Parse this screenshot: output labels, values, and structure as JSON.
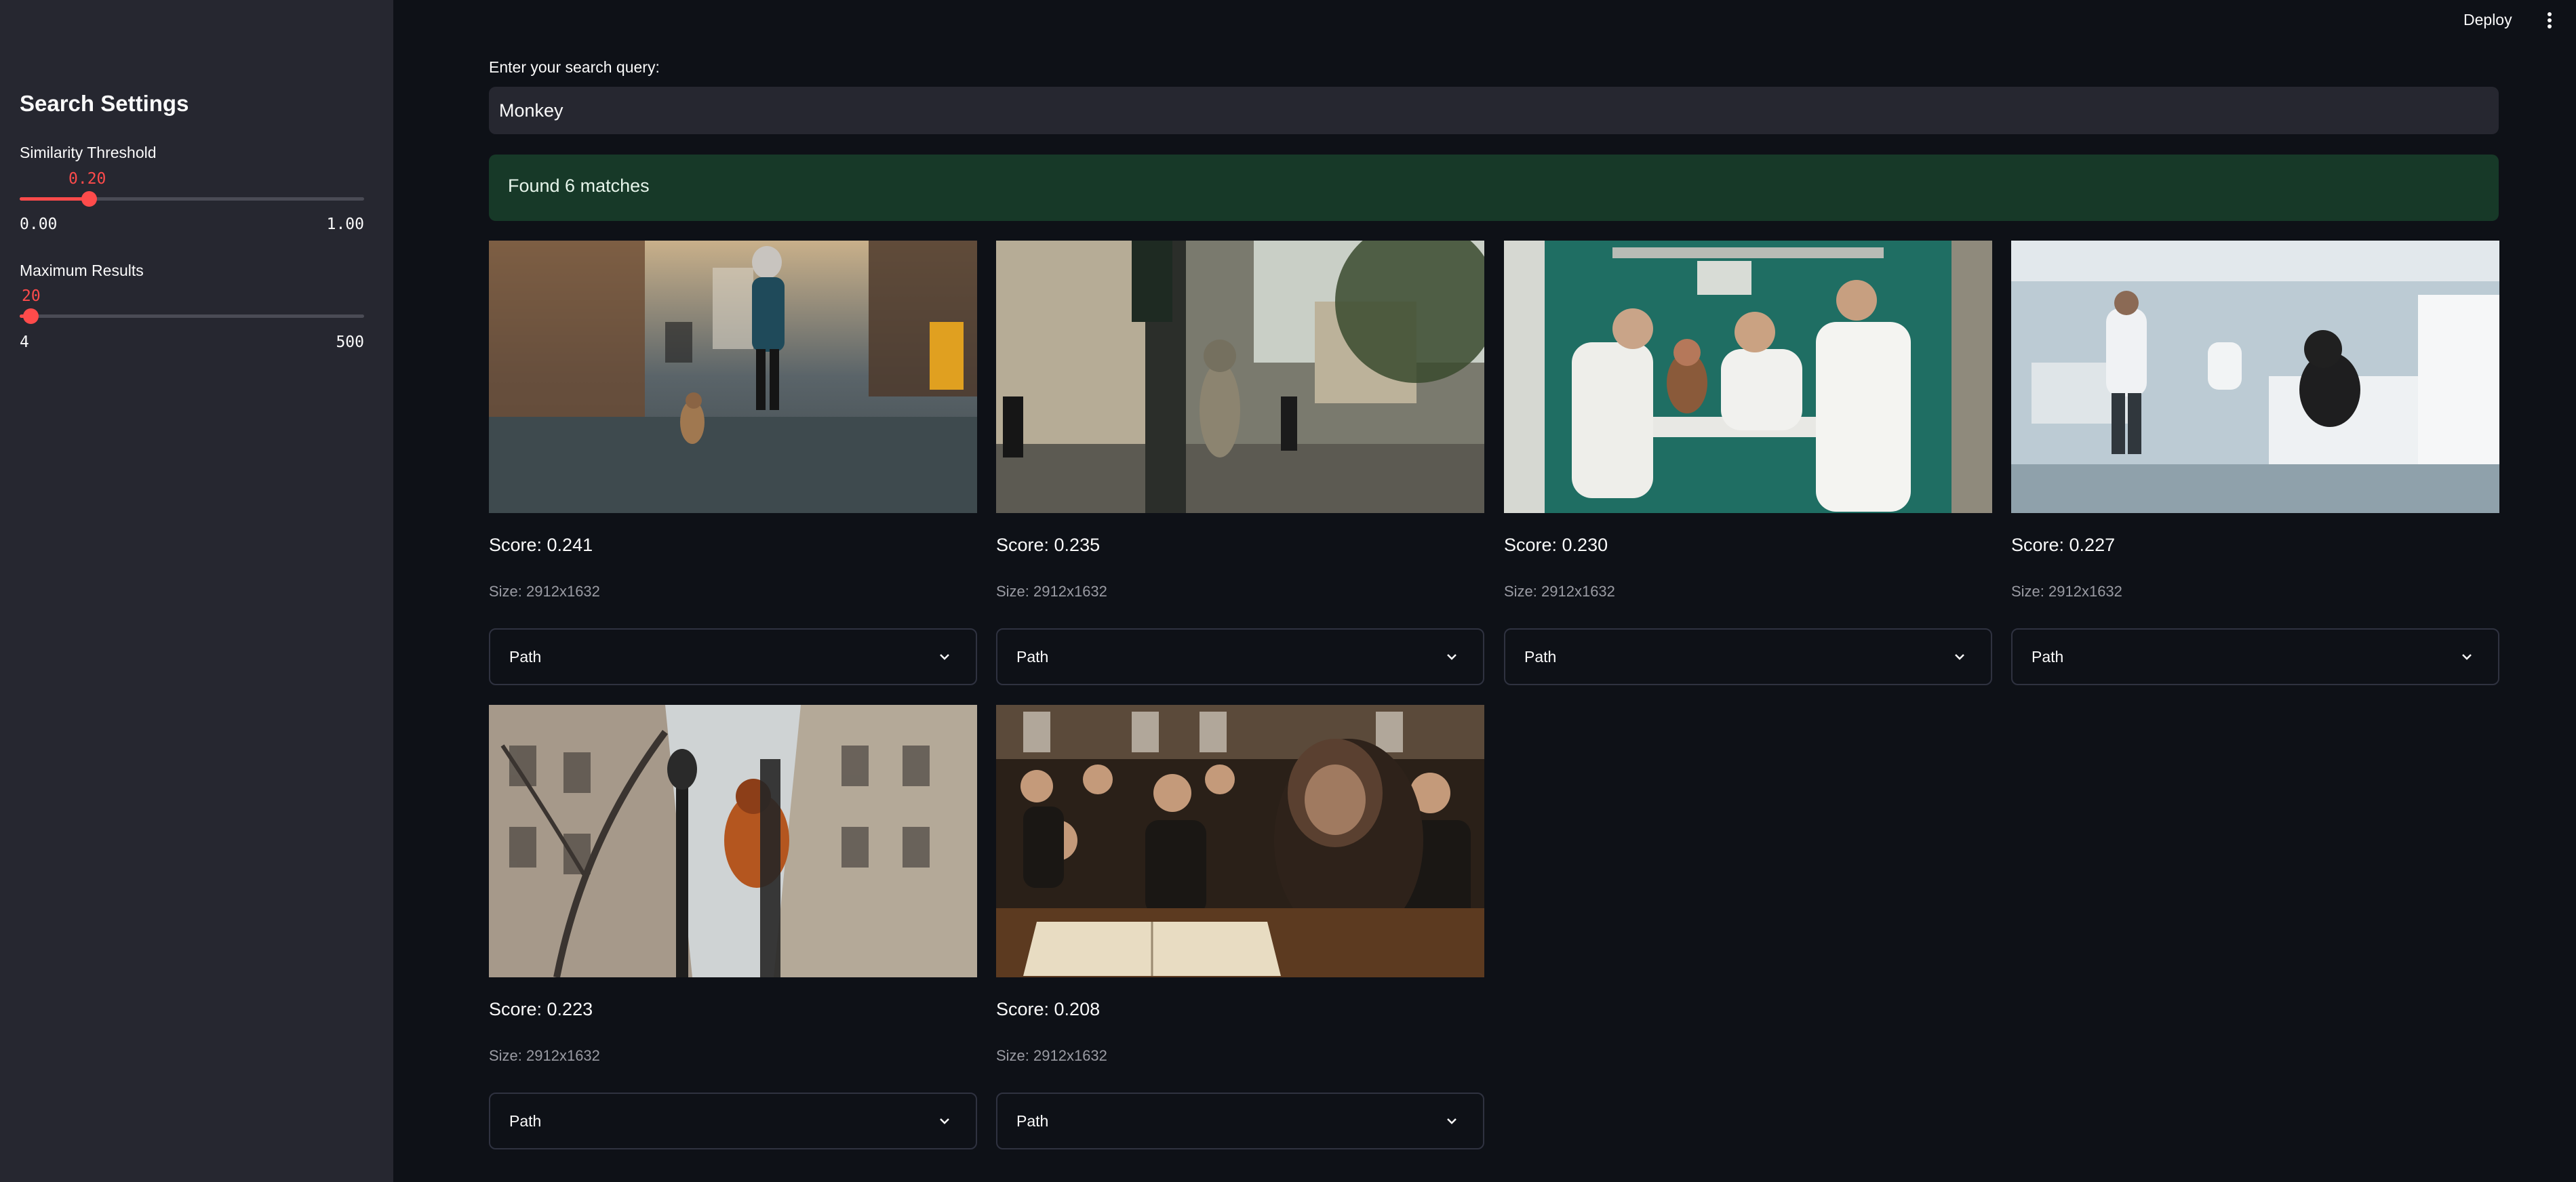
{
  "topbar": {
    "deploy_label": "Deploy",
    "menu_icon": "more-vert-icon"
  },
  "sidebar": {
    "title": "Search Settings",
    "similarity": {
      "label": "Similarity Threshold",
      "value": "0.20",
      "min": "0.00",
      "max": "1.00",
      "fraction": 0.2
    },
    "max_results": {
      "label": "Maximum Results",
      "value": "20",
      "min": "4",
      "max": "500",
      "fraction": 0.032
    }
  },
  "search": {
    "label": "Enter your search query:",
    "value": "Monkey"
  },
  "status": {
    "message": "Found 6 matches",
    "color": "#173928"
  },
  "accent_color": "#ff4b4b",
  "results": [
    {
      "score": "Score: 0.241",
      "size": "Size: 2912x1632",
      "expander": "Path",
      "scene": "street-walk"
    },
    {
      "score": "Score: 0.235",
      "size": "Size: 2912x1632",
      "expander": "Path",
      "scene": "paris-traffic"
    },
    {
      "score": "Score: 0.230",
      "size": "Size: 2912x1632",
      "expander": "Path",
      "scene": "doctors-room"
    },
    {
      "score": "Score: 0.227",
      "size": "Size: 2912x1632",
      "expander": "Path",
      "scene": "lab"
    },
    {
      "score": "Score: 0.223",
      "size": "Size: 2912x1632",
      "expander": "Path",
      "scene": "lamppost"
    },
    {
      "score": "Score: 0.208",
      "size": "Size: 2912x1632",
      "expander": "Path",
      "scene": "classroom"
    }
  ]
}
